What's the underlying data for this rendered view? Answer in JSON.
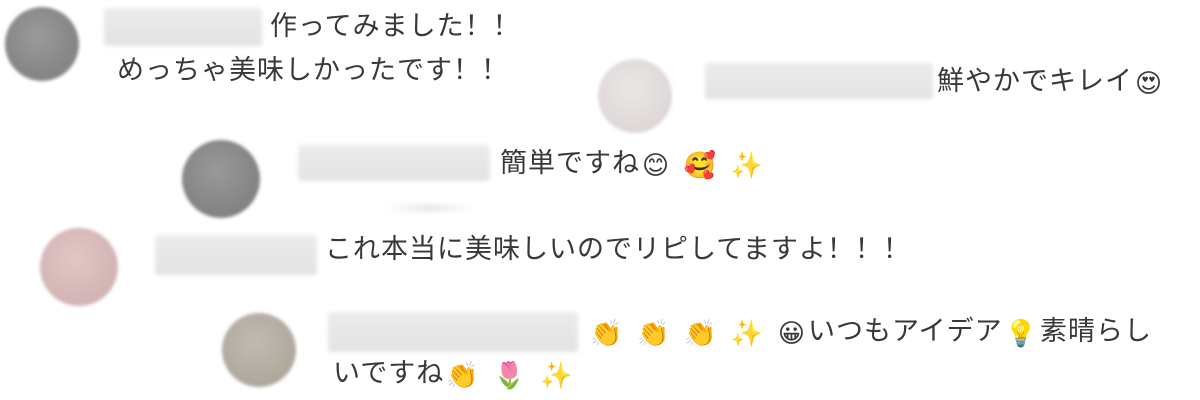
{
  "comments": [
    {
      "avatar_color": "#8c8c8c",
      "line1": "作ってみました！！",
      "line2": "めっちゃ美味しかったです！！"
    },
    {
      "avatar_color": "#e2dcdc",
      "text": "鮮やかでキレイ",
      "emoji": "😍"
    },
    {
      "avatar_color": "#8a8a8a",
      "text": "簡単ですね",
      "emojis": [
        "😊",
        "🥰",
        "✨"
      ]
    },
    {
      "avatar_color": "#d7b8b8",
      "text": "これ本当に美味しいのでリピしてますよ！！！"
    },
    {
      "avatar_color": "#b4afa3",
      "emojis_lead": [
        "👏",
        "👏",
        "👏",
        "✨",
        "😀"
      ],
      "text_a": "いつもアイデア",
      "emoji_mid": "💡",
      "text_b": "素晴らし",
      "text_c": "いですね",
      "emojis_tail": [
        "👏",
        "🌷",
        "✨"
      ]
    }
  ]
}
